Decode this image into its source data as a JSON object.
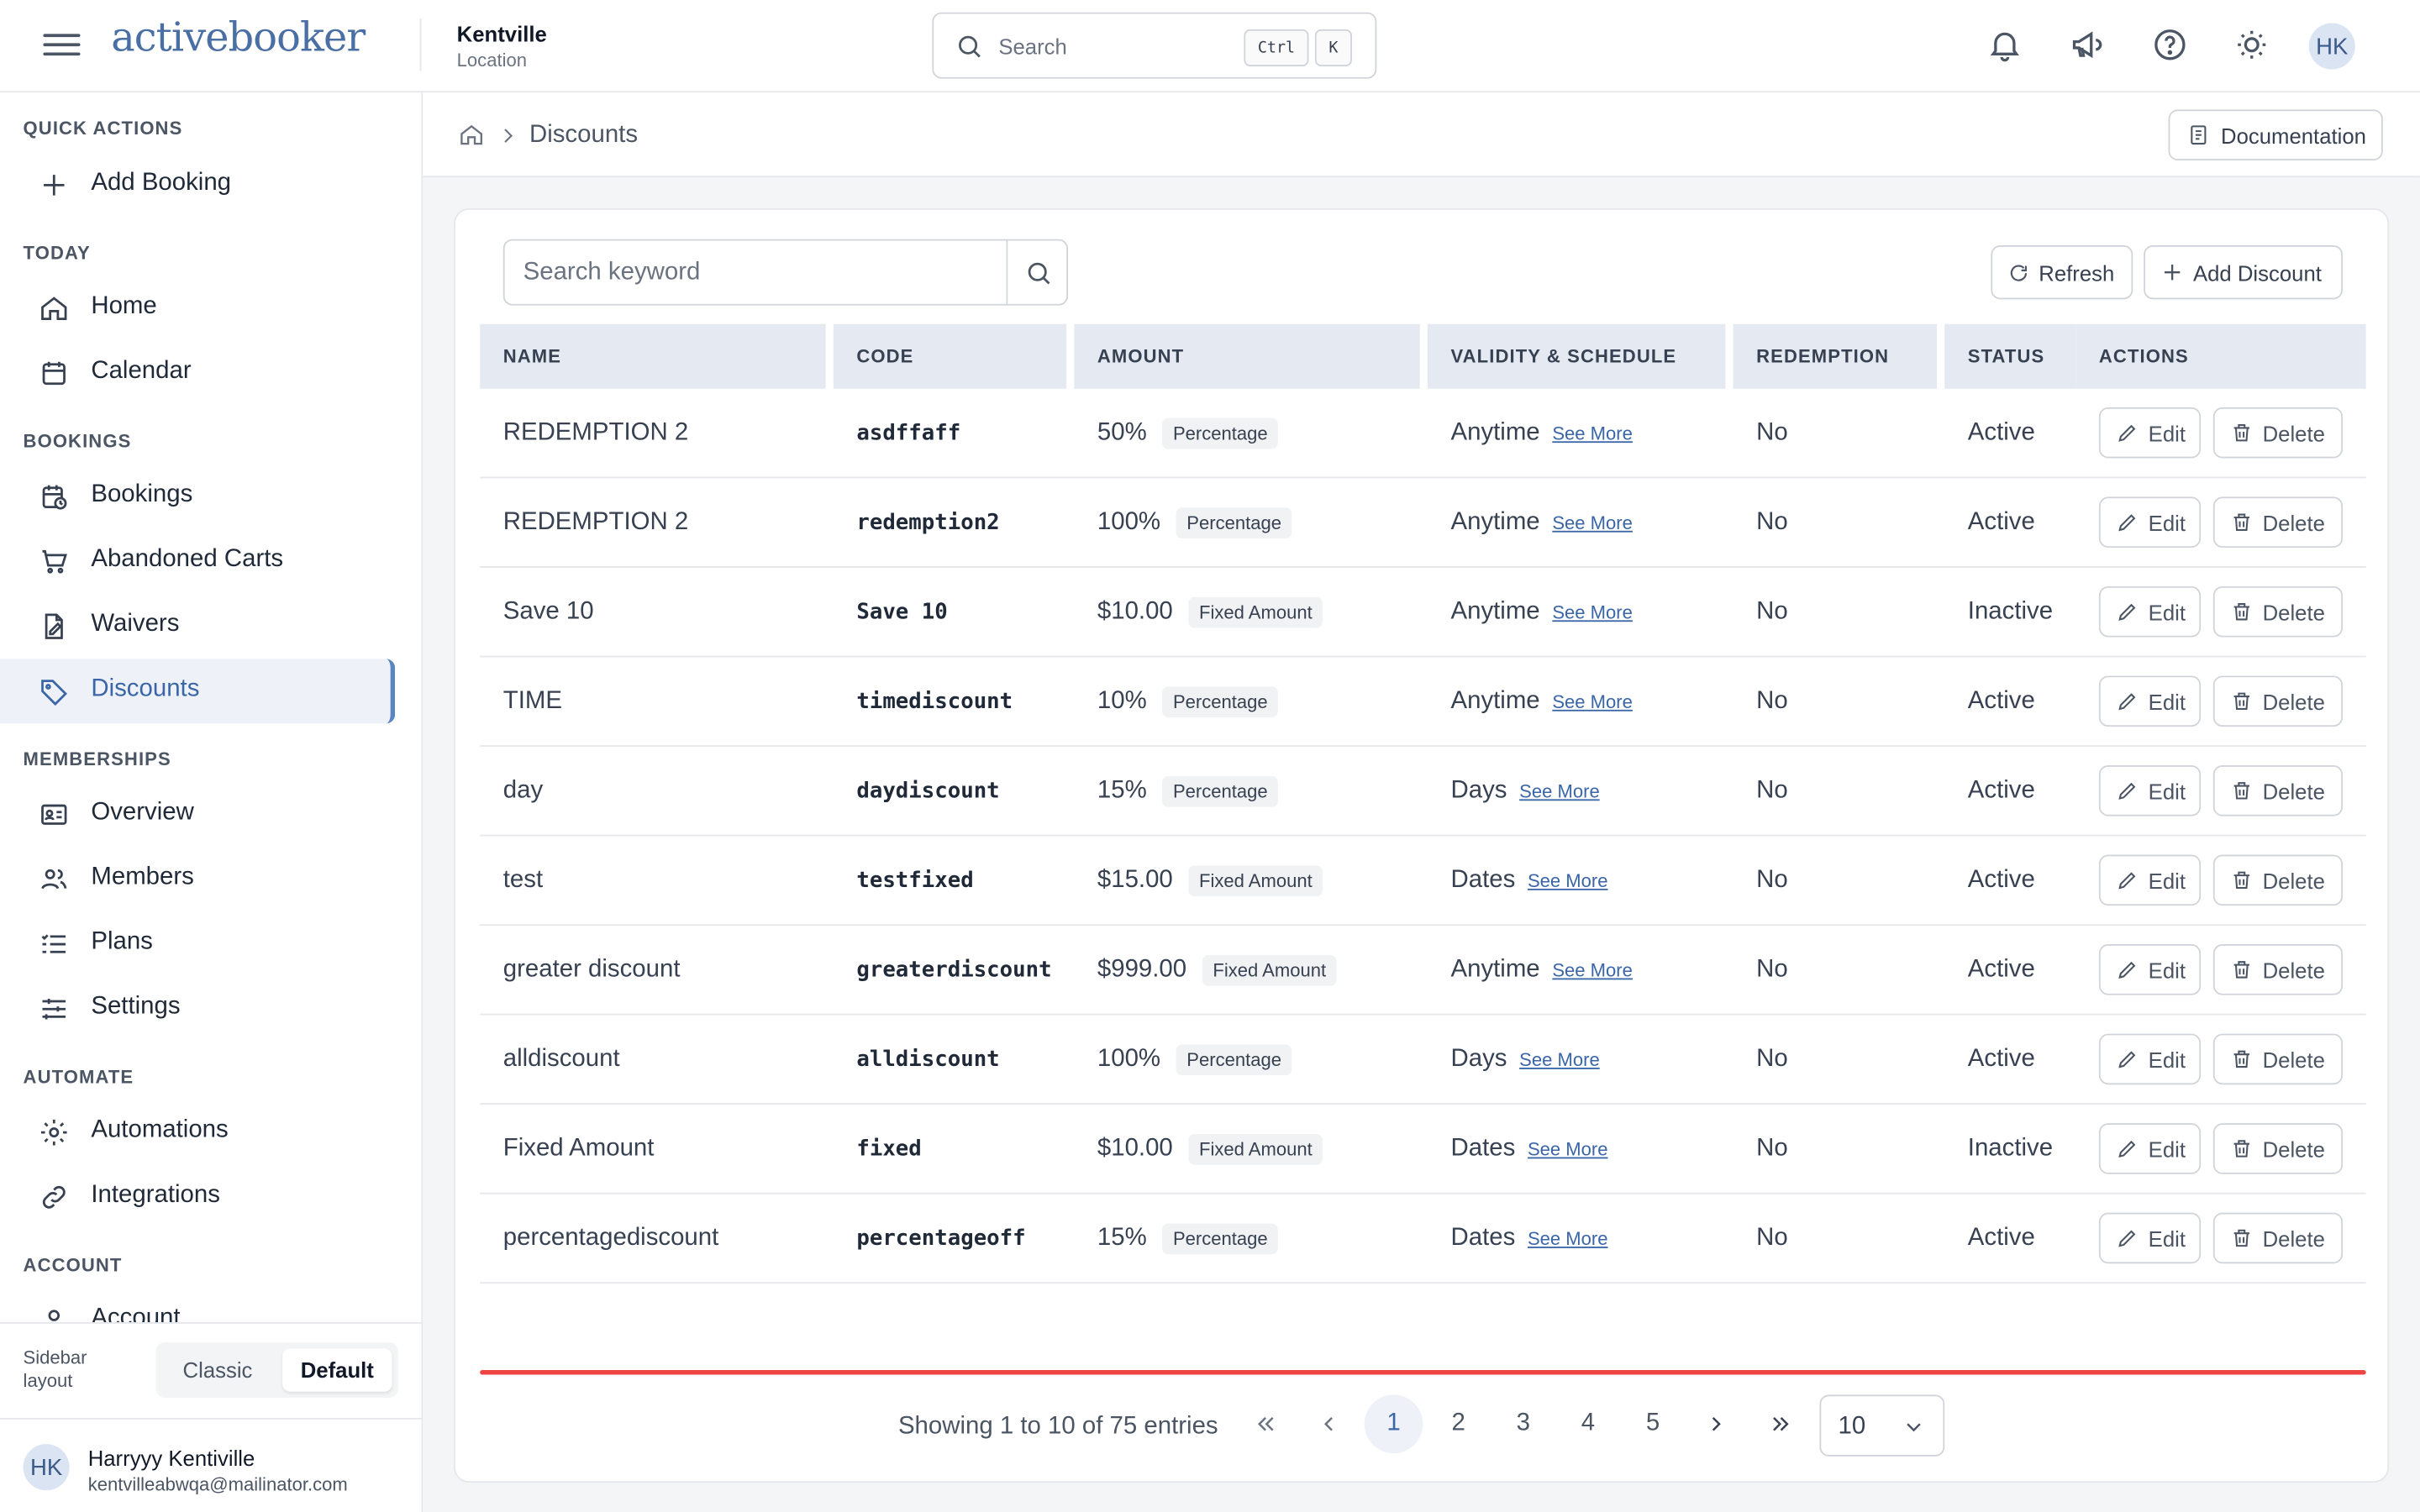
{
  "header": {
    "logo": "activebooker",
    "location_name": "Kentville",
    "location_sub": "Location",
    "search_placeholder": "Search",
    "shortcut_ctrl": "Ctrl",
    "shortcut_key": "K",
    "avatar_initials": "HK",
    "icons": [
      "menu-icon",
      "bell-icon",
      "megaphone-icon",
      "help-icon",
      "sun-icon"
    ]
  },
  "sidebar": {
    "sections": [
      {
        "label": "QUICK ACTIONS",
        "items": [
          {
            "label": "Add Booking",
            "icon": "plus-icon"
          }
        ]
      },
      {
        "label": "TODAY",
        "items": [
          {
            "label": "Home",
            "icon": "home-icon"
          },
          {
            "label": "Calendar",
            "icon": "calendar-icon"
          }
        ]
      },
      {
        "label": "BOOKINGS",
        "items": [
          {
            "label": "Bookings",
            "icon": "calendar-clock-icon"
          },
          {
            "label": "Abandoned Carts",
            "icon": "cart-icon"
          },
          {
            "label": "Waivers",
            "icon": "file-signature-icon"
          },
          {
            "label": "Discounts",
            "icon": "tag-icon",
            "active": true
          }
        ]
      },
      {
        "label": "MEMBERSHIPS",
        "items": [
          {
            "label": "Overview",
            "icon": "id-card-icon"
          },
          {
            "label": "Members",
            "icon": "users-icon"
          },
          {
            "label": "Plans",
            "icon": "list-icon"
          },
          {
            "label": "Settings",
            "icon": "sliders-icon"
          }
        ]
      },
      {
        "label": "AUTOMATE",
        "items": [
          {
            "label": "Automations",
            "icon": "gear-icon"
          },
          {
            "label": "Integrations",
            "icon": "link-icon"
          }
        ]
      },
      {
        "label": "ACCOUNT",
        "items": [
          {
            "label": "Account",
            "icon": "user-icon"
          }
        ]
      }
    ],
    "layout_label": "Sidebar layout",
    "layout_options": [
      "Classic",
      "Default"
    ],
    "layout_selected": "Default",
    "user": {
      "initials": "HK",
      "name": "Harryyy Kentiville",
      "email": "kentvilleabwqa@mailinator.com"
    }
  },
  "breadcrumb": {
    "current": "Discounts"
  },
  "documentation_label": "Documentation",
  "toolbar": {
    "search_placeholder": "Search keyword",
    "refresh_label": "Refresh",
    "add_label": "Add Discount"
  },
  "table": {
    "columns": [
      "NAME",
      "CODE",
      "AMOUNT",
      "VALIDITY & SCHEDULE",
      "REDEMPTION",
      "STATUS",
      "ACTIONS"
    ],
    "edit_label": "Edit",
    "delete_label": "Delete",
    "see_more_label": "See More",
    "rows": [
      {
        "name": "REDEMPTION 2",
        "code": "asdffaff",
        "amount": "50%",
        "type": "Percentage",
        "validity": "Anytime",
        "redemption": "No",
        "status": "Active"
      },
      {
        "name": "REDEMPTION 2",
        "code": "redemption2",
        "amount": "100%",
        "type": "Percentage",
        "validity": "Anytime",
        "redemption": "No",
        "status": "Active"
      },
      {
        "name": "Save 10",
        "code": "Save 10",
        "amount": "$10.00",
        "type": "Fixed Amount",
        "validity": "Anytime",
        "redemption": "No",
        "status": "Inactive"
      },
      {
        "name": "TIME",
        "code": "timediscount",
        "amount": "10%",
        "type": "Percentage",
        "validity": "Anytime",
        "redemption": "No",
        "status": "Active"
      },
      {
        "name": "day",
        "code": "daydiscount",
        "amount": "15%",
        "type": "Percentage",
        "validity": "Days",
        "redemption": "No",
        "status": "Active"
      },
      {
        "name": "test",
        "code": "testfixed",
        "amount": "$15.00",
        "type": "Fixed Amount",
        "validity": "Dates",
        "redemption": "No",
        "status": "Active"
      },
      {
        "name": "greater discount",
        "code": "greaterdiscount",
        "amount": "$999.00",
        "type": "Fixed Amount",
        "validity": "Anytime",
        "redemption": "No",
        "status": "Active"
      },
      {
        "name": "alldiscount",
        "code": "alldiscount",
        "amount": "100%",
        "type": "Percentage",
        "validity": "Days",
        "redemption": "No",
        "status": "Active"
      },
      {
        "name": "Fixed Amount",
        "code": "fixed",
        "amount": "$10.00",
        "type": "Fixed Amount",
        "validity": "Dates",
        "redemption": "No",
        "status": "Inactive"
      },
      {
        "name": "percentagediscount",
        "code": "percentageoff",
        "amount": "15%",
        "type": "Percentage",
        "validity": "Dates",
        "redemption": "No",
        "status": "Active"
      }
    ]
  },
  "pagination": {
    "info": "Showing 1 to 10 of 75 entries",
    "pages": [
      "1",
      "2",
      "3",
      "4",
      "5"
    ],
    "current_page": "1",
    "per_page": "10"
  },
  "colors": {
    "accent": "#3a66a8",
    "header_bg": "#e5eaf2",
    "highlight": "#ef4444"
  }
}
